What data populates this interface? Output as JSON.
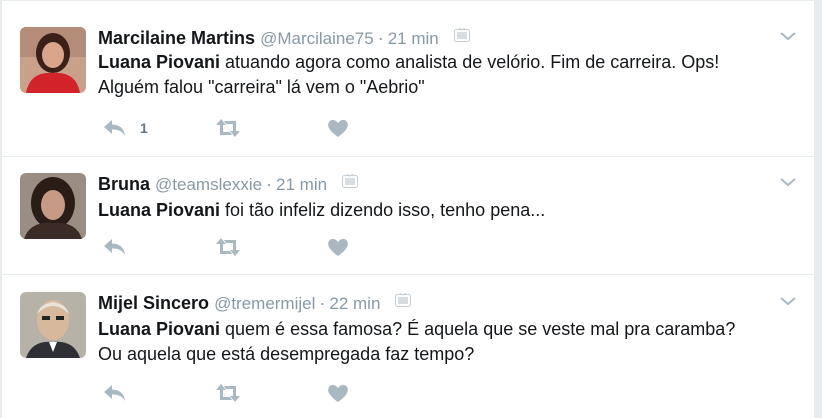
{
  "tweets": [
    {
      "name": "Marcilaine Martins",
      "handle": "@Marcilaine75",
      "separator": "·",
      "time": "21 min",
      "mention": "Luana Piovani",
      "text_line1": " atuando agora como analista de velório. Fim de carreira. Ops!",
      "text_line2": "Alguém falou \"carreira\" lá vem o \"Aebrio\"",
      "reply_count": "1"
    },
    {
      "name": "Bruna",
      "handle": "@teamslexxie",
      "separator": "·",
      "time": "21 min",
      "mention": "Luana Piovani",
      "text_line1": " foi tão infeliz dizendo isso, tenho pena...",
      "text_line2": "",
      "reply_count": ""
    },
    {
      "name": "Mijel Sincero",
      "handle": "@tremermijel",
      "separator": "·",
      "time": "22 min",
      "mention": "Luana Piovani",
      "text_line1": " quem é essa famosa? É aquela que se veste mal pra caramba?",
      "text_line2": "Ou aquela que está desempregada faz tempo?",
      "reply_count": ""
    }
  ],
  "icons": {
    "source": "broadcast-source-icon",
    "menu": "chevron-down-icon",
    "reply": "reply-icon",
    "retweet": "retweet-icon",
    "like": "heart-icon"
  },
  "colors": {
    "text": "#14171a",
    "secondary": "#8899a6",
    "action": "#aab8c2",
    "divider": "#e6ecf0"
  }
}
